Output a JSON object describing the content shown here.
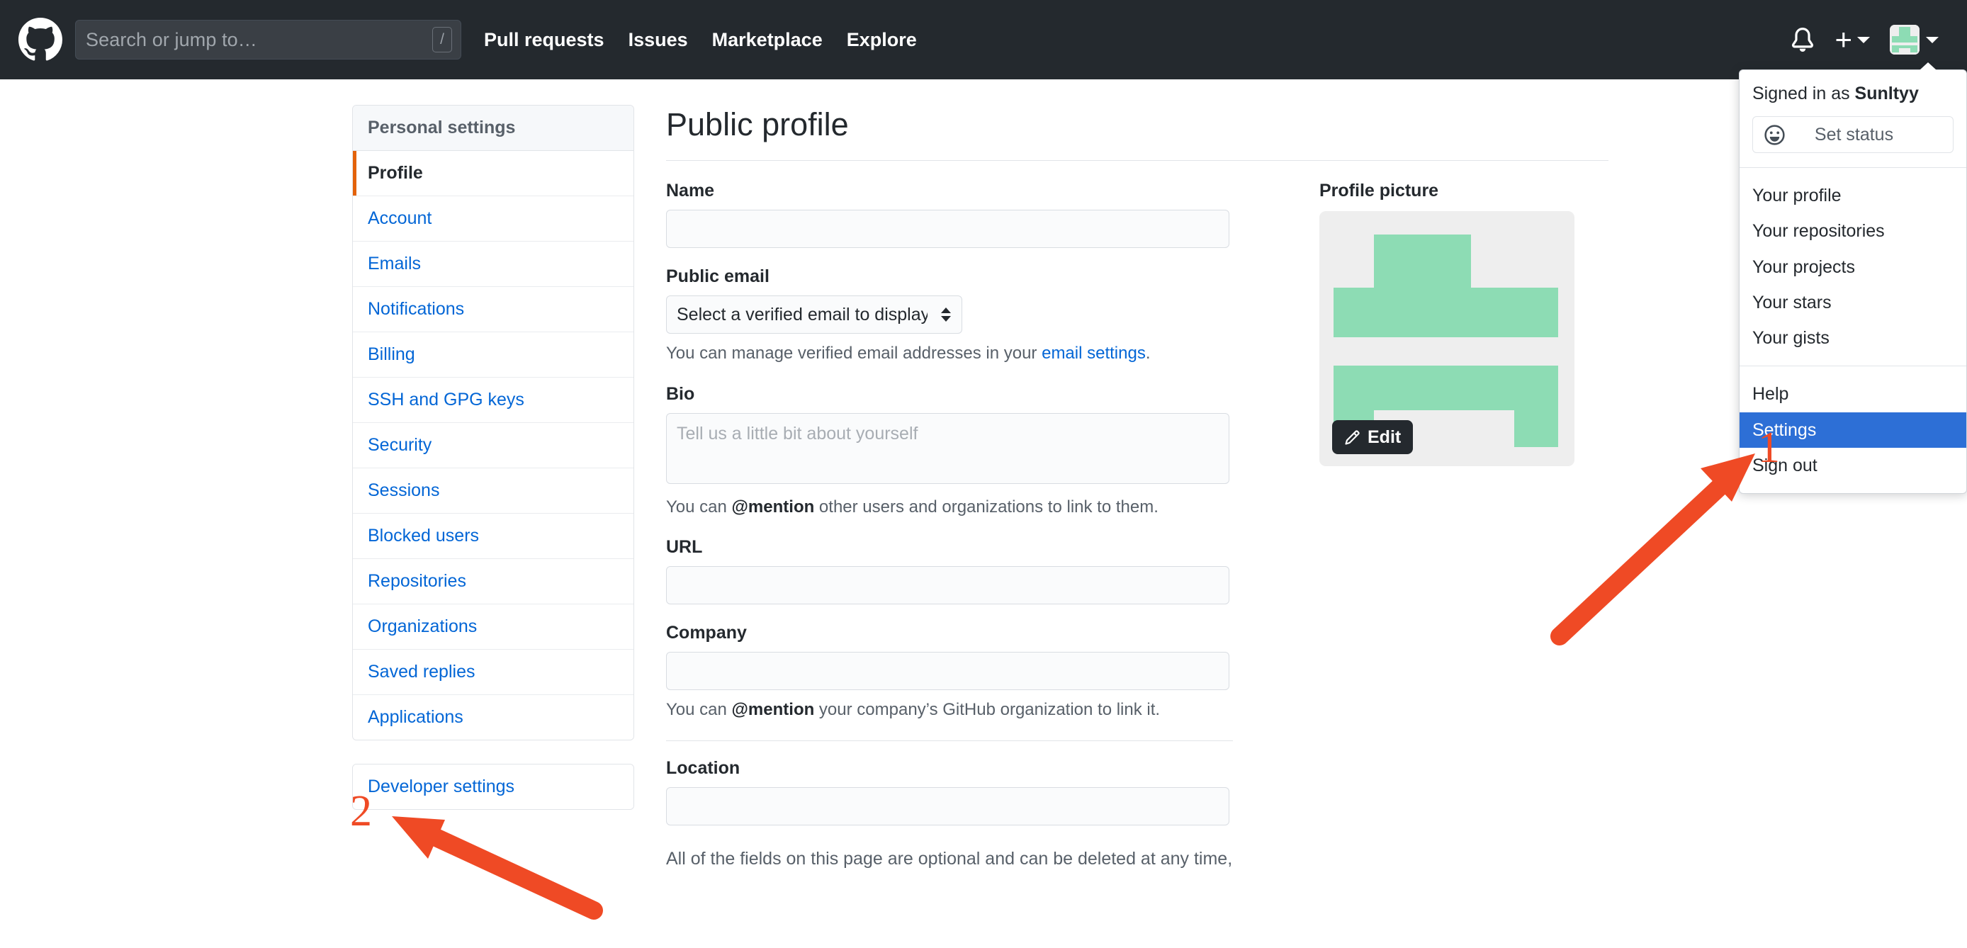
{
  "header": {
    "logo_icon": "github-logo-icon",
    "search": {
      "placeholder": "Search or jump to…",
      "shortcut_key": "/"
    },
    "nav": [
      {
        "label": "Pull requests"
      },
      {
        "label": "Issues"
      },
      {
        "label": "Marketplace"
      },
      {
        "label": "Explore"
      }
    ],
    "icons": {
      "notifications": "bell-icon",
      "create_new": "plus-icon",
      "avatar": "avatar-icon"
    }
  },
  "user_dropdown": {
    "signed_in_prefix": "Signed in as ",
    "username": "Sunltyy",
    "set_status_label": "Set status",
    "set_status_icon": "smiley-icon",
    "items": [
      {
        "label": "Your profile",
        "selected": false
      },
      {
        "label": "Your repositories",
        "selected": false
      },
      {
        "label": "Your projects",
        "selected": false
      },
      {
        "label": "Your stars",
        "selected": false
      },
      {
        "label": "Your gists",
        "selected": false
      }
    ],
    "items2": [
      {
        "label": "Help",
        "selected": false
      },
      {
        "label": "Settings",
        "selected": true
      },
      {
        "label": "Sign out",
        "selected": false
      }
    ]
  },
  "sidebar": {
    "header": "Personal settings",
    "items": [
      {
        "label": "Profile",
        "active": true
      },
      {
        "label": "Account",
        "active": false
      },
      {
        "label": "Emails",
        "active": false
      },
      {
        "label": "Notifications",
        "active": false
      },
      {
        "label": "Billing",
        "active": false
      },
      {
        "label": "SSH and GPG keys",
        "active": false
      },
      {
        "label": "Security",
        "active": false
      },
      {
        "label": "Sessions",
        "active": false
      },
      {
        "label": "Blocked users",
        "active": false
      },
      {
        "label": "Repositories",
        "active": false
      },
      {
        "label": "Organizations",
        "active": false
      },
      {
        "label": "Saved replies",
        "active": false
      },
      {
        "label": "Applications",
        "active": false
      }
    ],
    "developer_settings": "Developer settings"
  },
  "main": {
    "title": "Public profile",
    "name": {
      "label": "Name",
      "value": "",
      "placeholder": ""
    },
    "public_email": {
      "label": "Public email",
      "selected_option": "Select a verified email to display",
      "options": [
        "Select a verified email to display"
      ],
      "hint_prefix": "You can manage verified email addresses in your ",
      "hint_link": "email settings",
      "hint_suffix": "."
    },
    "bio": {
      "label": "Bio",
      "value": "",
      "placeholder": "Tell us a little bit about yourself",
      "hint_prefix": "You can ",
      "hint_bold": "@mention",
      "hint_suffix": " other users and organizations to link to them."
    },
    "url": {
      "label": "URL",
      "value": "",
      "placeholder": ""
    },
    "company": {
      "label": "Company",
      "value": "",
      "placeholder": "",
      "hint_prefix": "You can ",
      "hint_bold": "@mention",
      "hint_suffix": " your company’s GitHub organization to link it."
    },
    "location": {
      "label": "Location",
      "value": "",
      "placeholder": ""
    },
    "footnote": "All of the fields on this page are optional and can be deleted at any time,",
    "profile_picture": {
      "label": "Profile picture",
      "edit_label": "Edit",
      "edit_icon": "pencil-icon"
    }
  },
  "annotations": {
    "step1": "1",
    "step2": "2",
    "arrow_color": "#ef4a25"
  },
  "colors": {
    "header_bg": "#24292e",
    "link_blue": "#0366d6",
    "selected_blue": "#2d6fd6",
    "active_orange": "#e36209",
    "annotation_orange": "#ef4a25",
    "avatar_green": "#8ddcb4",
    "panel_border": "#e1e4e8",
    "muted_text": "#586069"
  }
}
